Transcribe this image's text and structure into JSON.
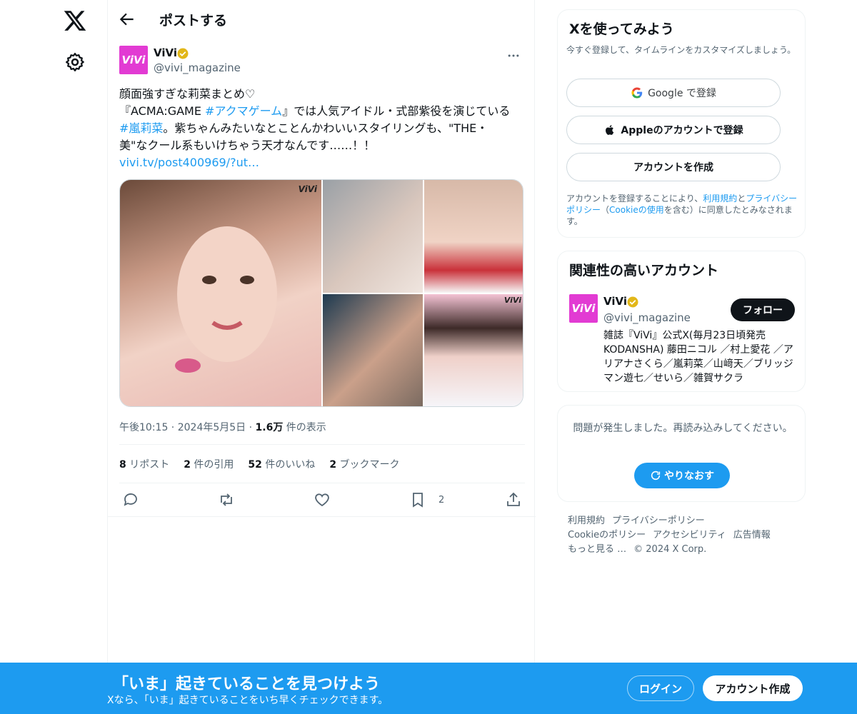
{
  "header": {
    "title": "ポストする"
  },
  "post": {
    "author_name": "ViVi",
    "author_handle": "@vivi_magazine",
    "avatar_text": "ViVi",
    "text_line1": "顔面強すぎな莉菜まとめ♡",
    "text_line2_a": "『ACMA:GAME ",
    "text_line2_hashtag": "#アクマゲーム",
    "text_line2_b": "』では人気アイドル・式部紫役を演じている",
    "text_line3_hashtag": "#嵐莉菜",
    "text_line3_b": "。紫ちゃんみたいなとことんかわいいスタイリングも、\"THE・",
    "text_line4": "美\"なクール系もいけちゃう天才なんです……！！",
    "link": "vivi.tv/post400969/?ut…",
    "image_watermark": "ViVi",
    "time": "午後10:15",
    "date": "2024年5月5日",
    "views_count": "1.6万",
    "views_label": "件の表示",
    "stats": {
      "reposts_count": "8",
      "reposts_label": "リポスト",
      "quotes_count": "2",
      "quotes_label": "件の引用",
      "likes_count": "52",
      "likes_label": "件のいいね",
      "bookmarks_count": "2",
      "bookmarks_label": "ブックマーク"
    },
    "bookmark_action_count": "2"
  },
  "signup_card": {
    "title": "Xを使ってみよう",
    "subtitle": "今すぐ登録して、タイムラインをカスタマイズしましょう。",
    "google_label": "Google で登録",
    "apple_label": "Appleのアカウントで登録",
    "create_label": "アカウントを作成",
    "terms_a": "アカウントを登録することにより、",
    "terms_link1": "利用規約",
    "terms_b": "と",
    "terms_link2": "プライバシーポリシー",
    "terms_c": "（",
    "terms_link3": "Cookieの使用",
    "terms_d": "を含む）に同意したとみなされます。"
  },
  "related": {
    "title": "関連性の高いアカウント",
    "name": "ViVi",
    "handle": "@vivi_magazine",
    "follow_label": "フォロー",
    "bio": "雑誌『ViVi』公式X(毎月23日頃発売 KODANSHA) 藤田ニコル ／村上愛花 ／アリアナさくら／嵐莉菜／山﨑天／ブリッジマン遊七／せいら／雑賀サクラ"
  },
  "error_card": {
    "message": "問題が発生しました。再読み込みしてください。",
    "retry_label": "やりなおす"
  },
  "footer": {
    "terms": "利用規約",
    "privacy": "プライバシーポリシー",
    "cookie": "Cookieのポリシー",
    "accessibility": "アクセシビリティ",
    "ads": "広告情報",
    "more": "もっと見る …",
    "copyright": "© 2024 X Corp."
  },
  "banner": {
    "title": "「いま」起きていることを見つけよう",
    "subtitle": "Xなら、「いま」起きていることをいち早くチェックできます。",
    "login_label": "ログイン",
    "signup_label": "アカウント作成"
  },
  "colors": {
    "accent": "#1d9bf0",
    "avatar": "#e23bd3",
    "verified": "#e2b719"
  }
}
